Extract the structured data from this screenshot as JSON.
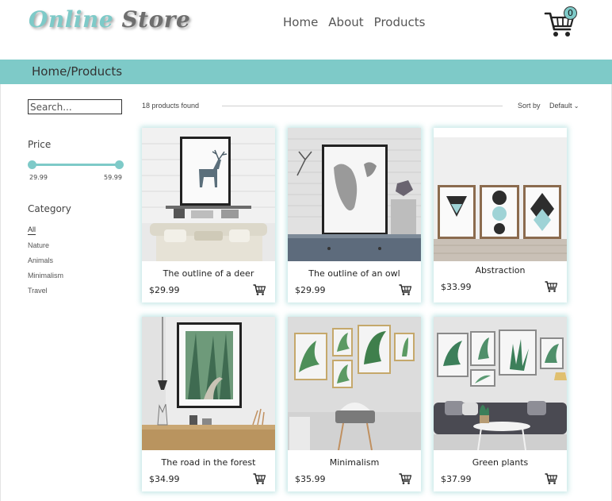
{
  "header": {
    "logo_word1": "Online",
    "logo_word2": "Store",
    "nav": [
      "Home",
      "About",
      "Products"
    ],
    "cart_count": "0"
  },
  "breadcrumb": "Home/Products",
  "sidebar": {
    "search_placeholder": "Search...",
    "price_title": "Price",
    "price_min": "29.99",
    "price_max": "59.99",
    "category_title": "Category",
    "categories": [
      "All",
      "Nature",
      "Animals",
      "Minimalism",
      "Travel"
    ]
  },
  "toolbar": {
    "found": "18 products found",
    "sort_label": "Sort by",
    "sort_value": "Default"
  },
  "products": [
    {
      "name": "The outline of a deer",
      "price": "$29.99"
    },
    {
      "name": "The outline of an owl",
      "price": "$29.99"
    },
    {
      "name": "Abstraction",
      "price": "$33.99"
    },
    {
      "name": "The road in the forest",
      "price": "$34.99"
    },
    {
      "name": "Minimalism",
      "price": "$35.99"
    },
    {
      "name": "Green plants",
      "price": "$37.99"
    }
  ],
  "colors": {
    "accent": "#7ecac8",
    "text": "#333333"
  }
}
